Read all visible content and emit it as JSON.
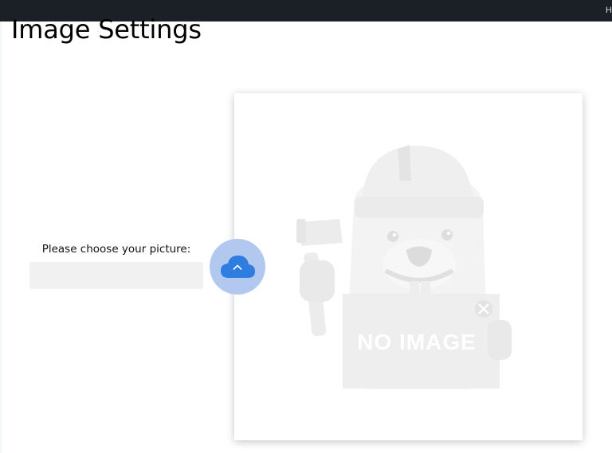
{
  "window": {
    "topbar_text": "H"
  },
  "page": {
    "title": "Image Settings"
  },
  "picker": {
    "label": "Please choose your picture:",
    "value": "",
    "placeholder": ""
  },
  "upload": {
    "icon": "cloud-upload-icon"
  },
  "preview": {
    "placeholder_text": "NO IMAGE",
    "placeholder_icon": "beaver-no-image-illustration"
  },
  "colors": {
    "topbar": "#1b2027",
    "upload_button": "#b2c8ee",
    "cloud_icon": "#2f7de1",
    "input_background": "#f1f1f2"
  }
}
